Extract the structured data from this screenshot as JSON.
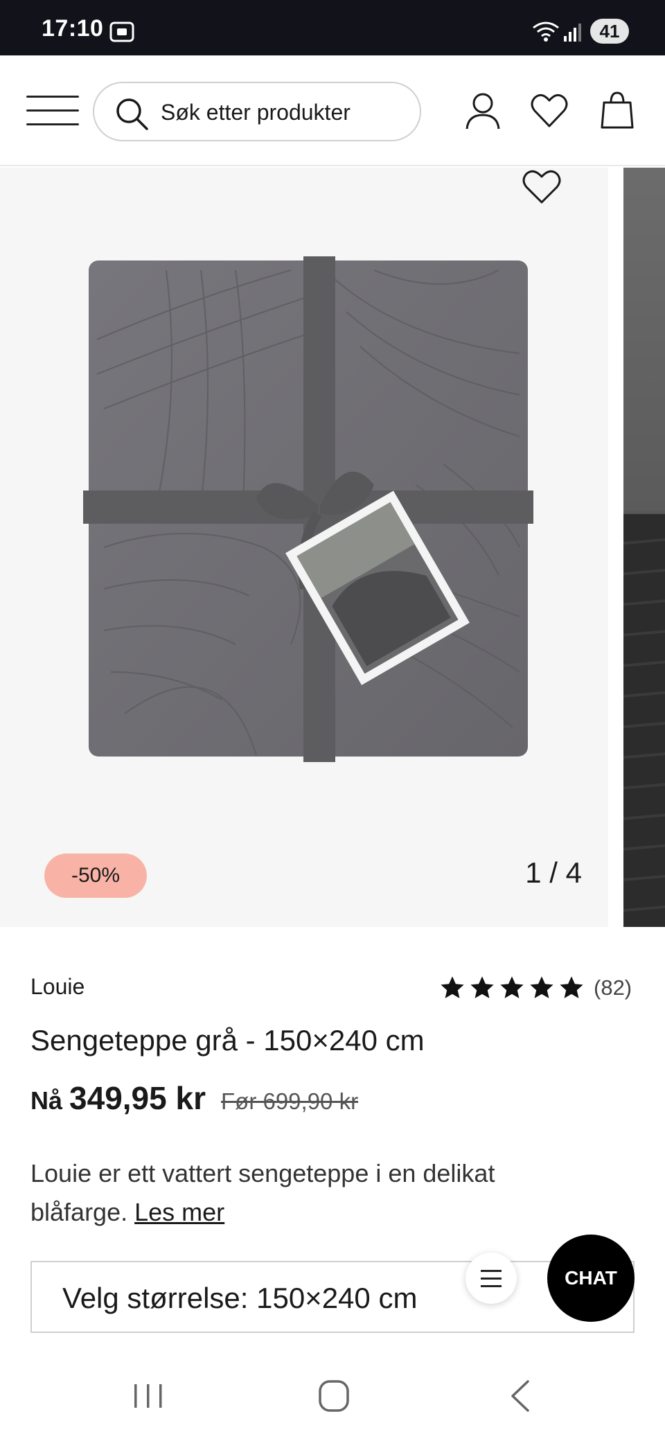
{
  "status_bar": {
    "time": "17:10",
    "battery": "41"
  },
  "header": {
    "search_placeholder": "Søk etter produkter"
  },
  "gallery": {
    "discount_badge": "-50%",
    "counter": "1 / 4"
  },
  "product": {
    "brand": "Louie",
    "rating": 5,
    "review_count": "(82)",
    "title": "Sengeteppe grå - 150×240 cm",
    "price_now_label": "Nå",
    "price_now": "349,95 kr",
    "price_before": "Før 699,90 kr",
    "description": "Louie er ett vattert sengeteppe i en delikat blåfarge.",
    "read_more": "Les mer",
    "size_select_label": "Velg størrelse: 150×240 cm"
  },
  "chat": {
    "label": "CHAT"
  },
  "colors": {
    "discount_badge_bg": "#f8b3a6",
    "chat_bg": "#000000",
    "status_bar_bg": "#12131a"
  }
}
